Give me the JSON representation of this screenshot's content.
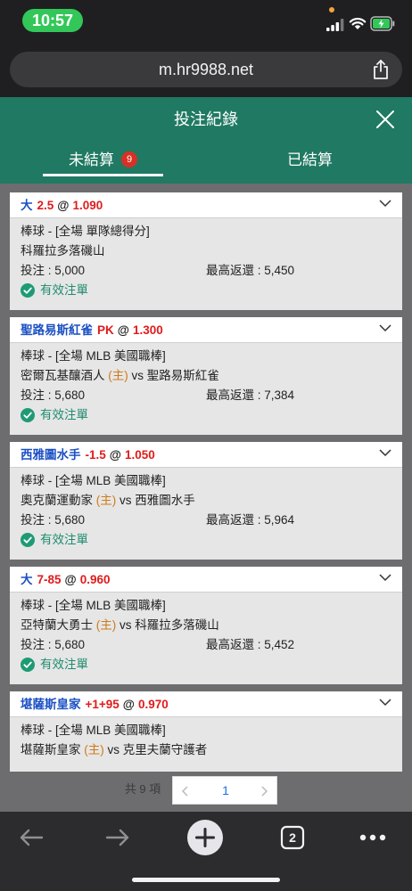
{
  "status_bar": {
    "time": "10:57"
  },
  "browser": {
    "url": "m.hr9988.net",
    "tab_count": "2"
  },
  "header": {
    "title": "投注紀錄"
  },
  "tabs": [
    {
      "label": "未結算",
      "badge": "9",
      "active": true
    },
    {
      "label": "已結算",
      "active": false
    }
  ],
  "bets": [
    {
      "pick": "大",
      "line": "2.5",
      "at": "@",
      "odds": "1.090",
      "market": "棒球 - [全場 單隊總得分]",
      "teams": {
        "plain": "科羅拉多落磯山"
      },
      "stake": "投注 : 5,000",
      "max_return": "最高返還 : 5,450",
      "status": "有效注單"
    },
    {
      "pick": "聖路易斯紅雀",
      "line": "PK",
      "at": "@",
      "odds": "1.300",
      "market": "棒球 - [全場 MLB 美國職棒]",
      "teams": {
        "home": "密爾瓦基釀酒人",
        "home_tag": "(主)",
        "vs": "vs",
        "away": "聖路易斯紅雀"
      },
      "stake": "投注 : 5,680",
      "max_return": "最高返還 : 7,384",
      "status": "有效注單"
    },
    {
      "pick": "西雅圖水手",
      "line": "-1.5",
      "at": "@",
      "odds": "1.050",
      "market": "棒球 - [全場 MLB 美國職棒]",
      "teams": {
        "home": "奧克蘭運動家",
        "home_tag": "(主)",
        "vs": "vs",
        "away": "西雅圖水手"
      },
      "stake": "投注 : 5,680",
      "max_return": "最高返還 : 5,964",
      "status": "有效注單"
    },
    {
      "pick": "大",
      "line": "7-85",
      "at": "@",
      "odds": "0.960",
      "market": "棒球 - [全場 MLB 美國職棒]",
      "teams": {
        "home": "亞特蘭大勇士",
        "home_tag": "(主)",
        "vs": "vs",
        "away": "科羅拉多落磯山"
      },
      "stake": "投注 : 5,680",
      "max_return": "最高返還 : 5,452",
      "status": "有效注單"
    },
    {
      "pick": "堪薩斯皇家",
      "line": "+1+95",
      "at": "@",
      "odds": "0.970",
      "market": "棒球 - [全場 MLB 美國職棒]",
      "teams": {
        "home": "堪薩斯皇家",
        "home_tag": "(主)",
        "vs": "vs",
        "away": "克里夫蘭守護者"
      }
    }
  ],
  "pagination": {
    "total": "共 9 項",
    "current_page": "1"
  },
  "colors": {
    "theme_green": "#207962",
    "pick_blue": "#1a4fc4",
    "odds_red": "#e01b1b",
    "home_orange": "#d07a18",
    "valid_green": "#1e8c6e"
  }
}
